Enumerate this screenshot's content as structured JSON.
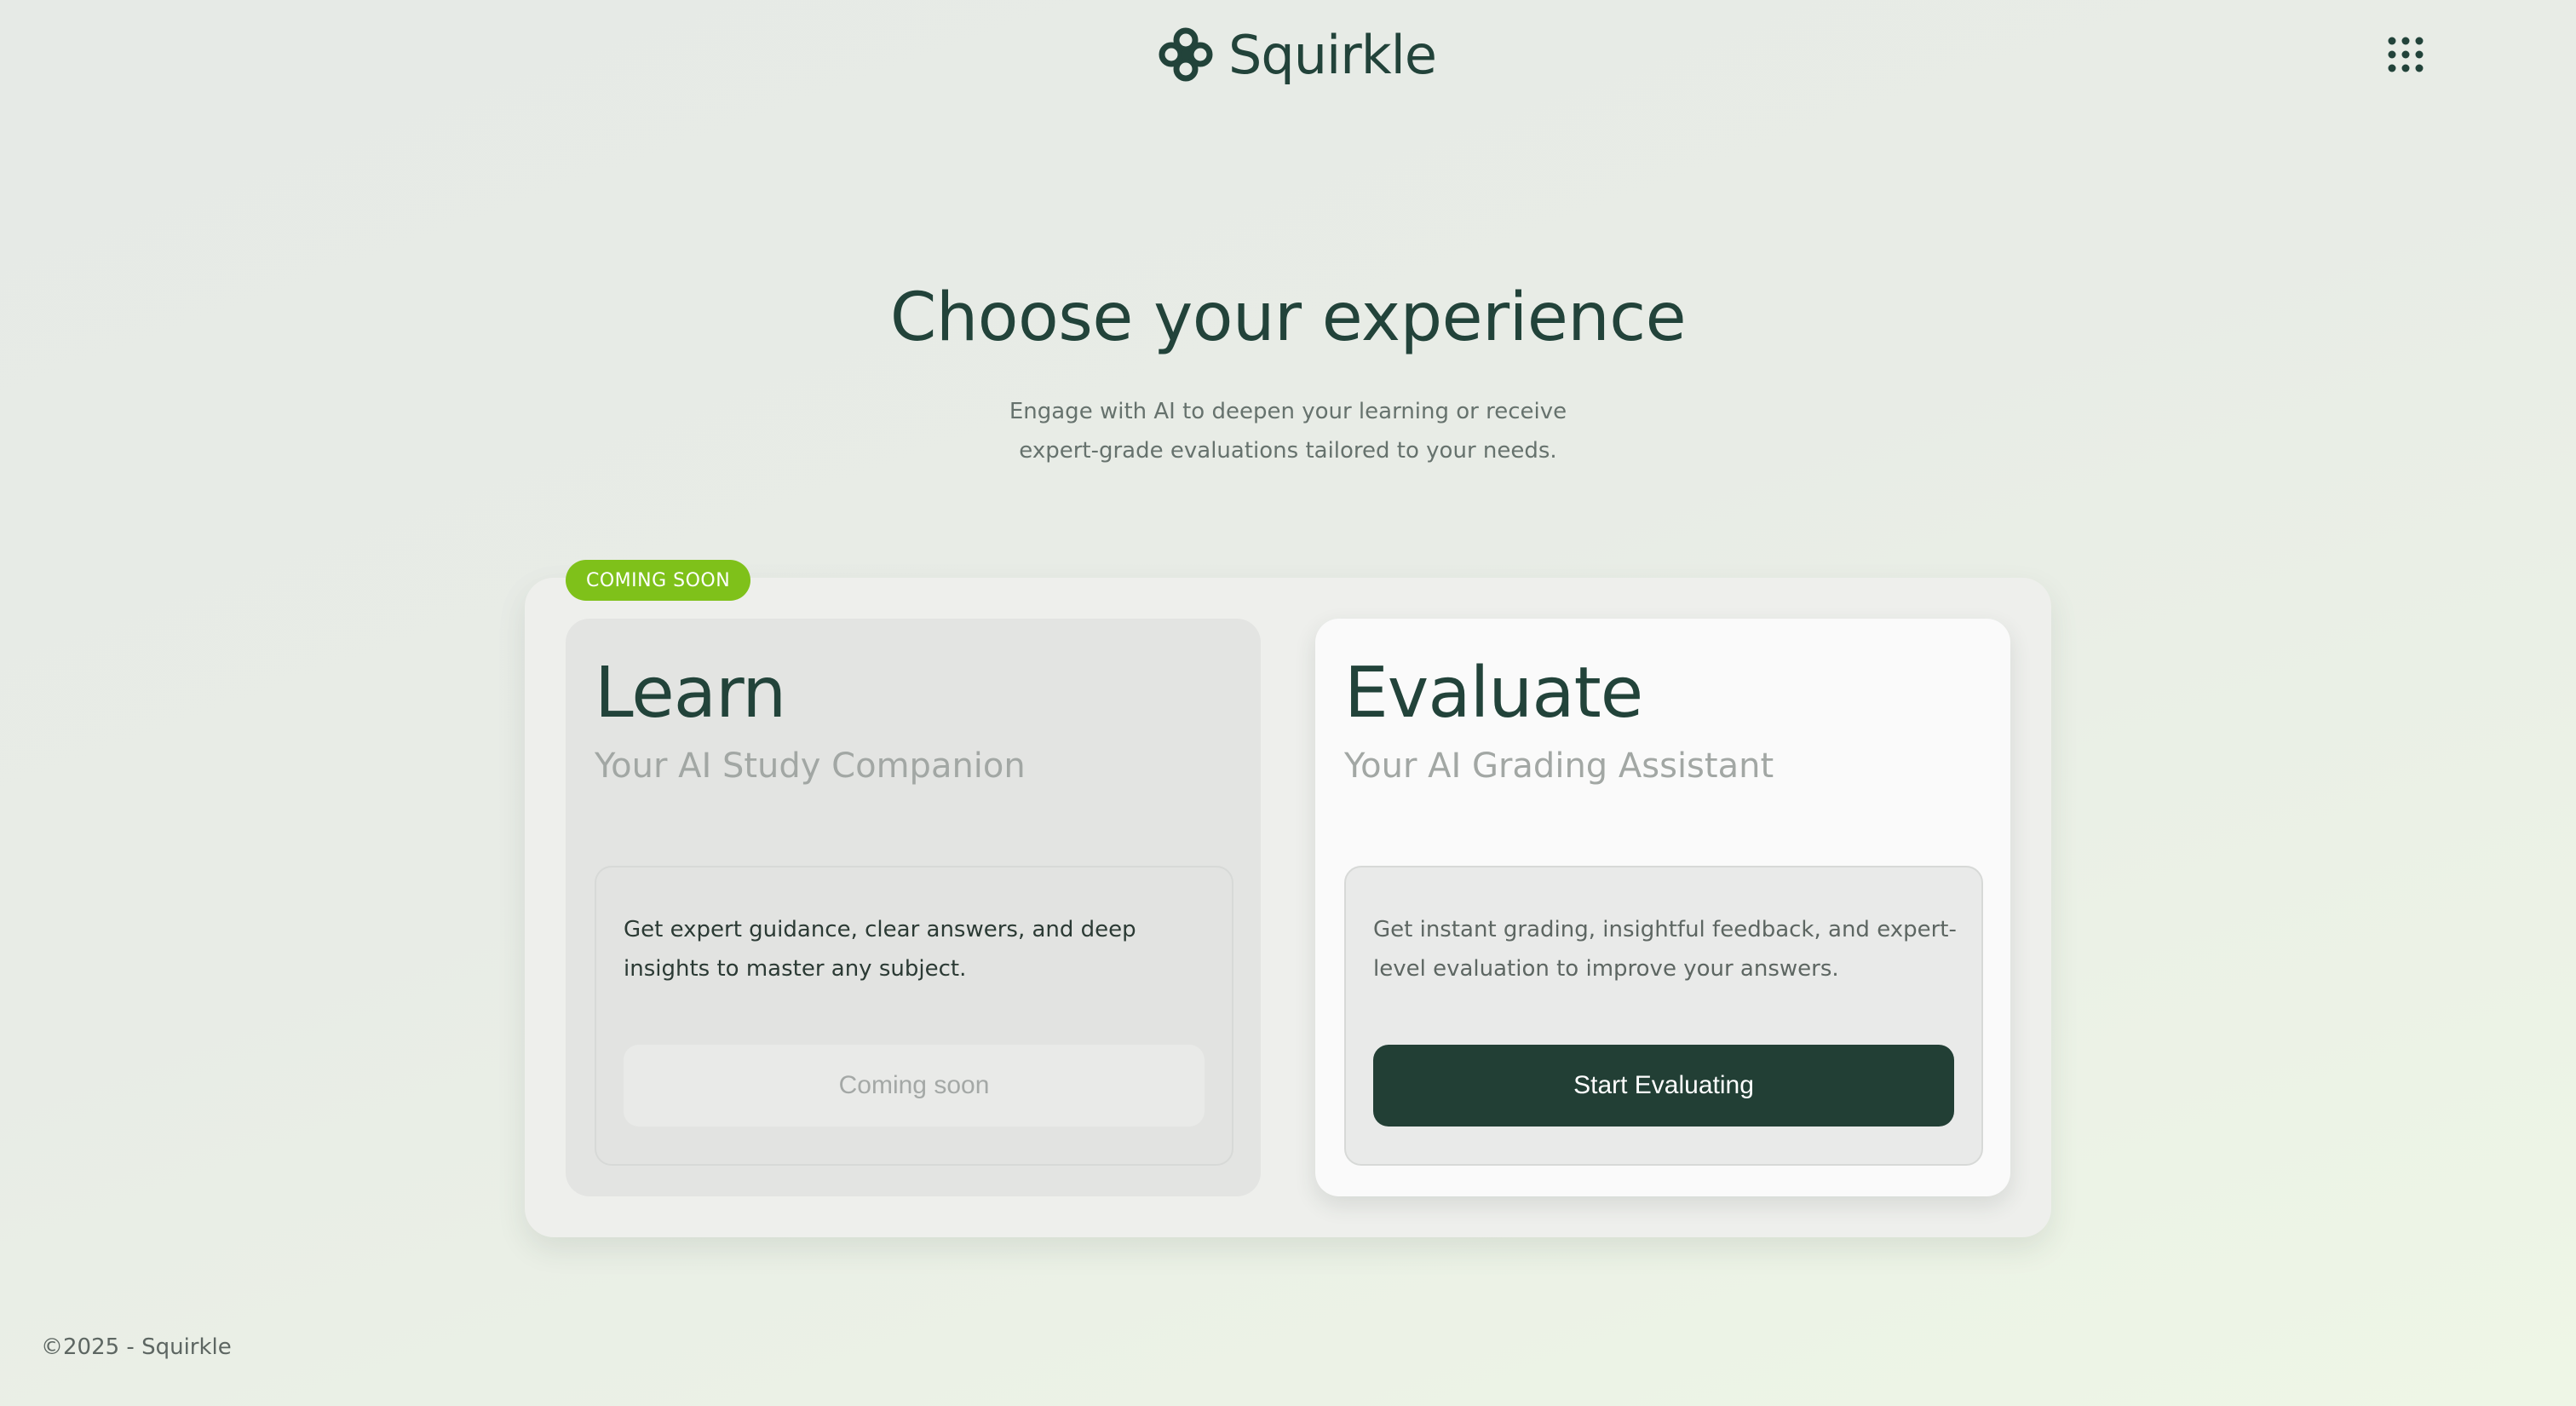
{
  "header": {
    "logo_text": "Squirkle",
    "logo_icon": "squirkle-flower-icon",
    "apps_icon": "grid-dots-icon"
  },
  "hero": {
    "title": "Choose your experience",
    "subtitle_line1": "Engage with AI to deepen your learning or receive",
    "subtitle_line2": "expert-grade evaluations tailored to your needs."
  },
  "cards": {
    "learn": {
      "badge": "COMING SOON",
      "title": "Learn",
      "subtitle": "Your AI Study Companion",
      "description": "Get expert guidance, clear answers, and deep insights to master any subject.",
      "button_label": "Coming soon"
    },
    "evaluate": {
      "title": "Evaluate",
      "subtitle": "Your AI Grading Assistant",
      "description": "Get instant grading, insightful feedback, and expert-level evaluation to improve your answers.",
      "button_label": "Start Evaluating"
    }
  },
  "footer": {
    "copyright": "©2025 - Squirkle"
  },
  "colors": {
    "brand_dark": "#223f35",
    "badge_green": "#7fc11a",
    "muted_text": "#66726d"
  }
}
